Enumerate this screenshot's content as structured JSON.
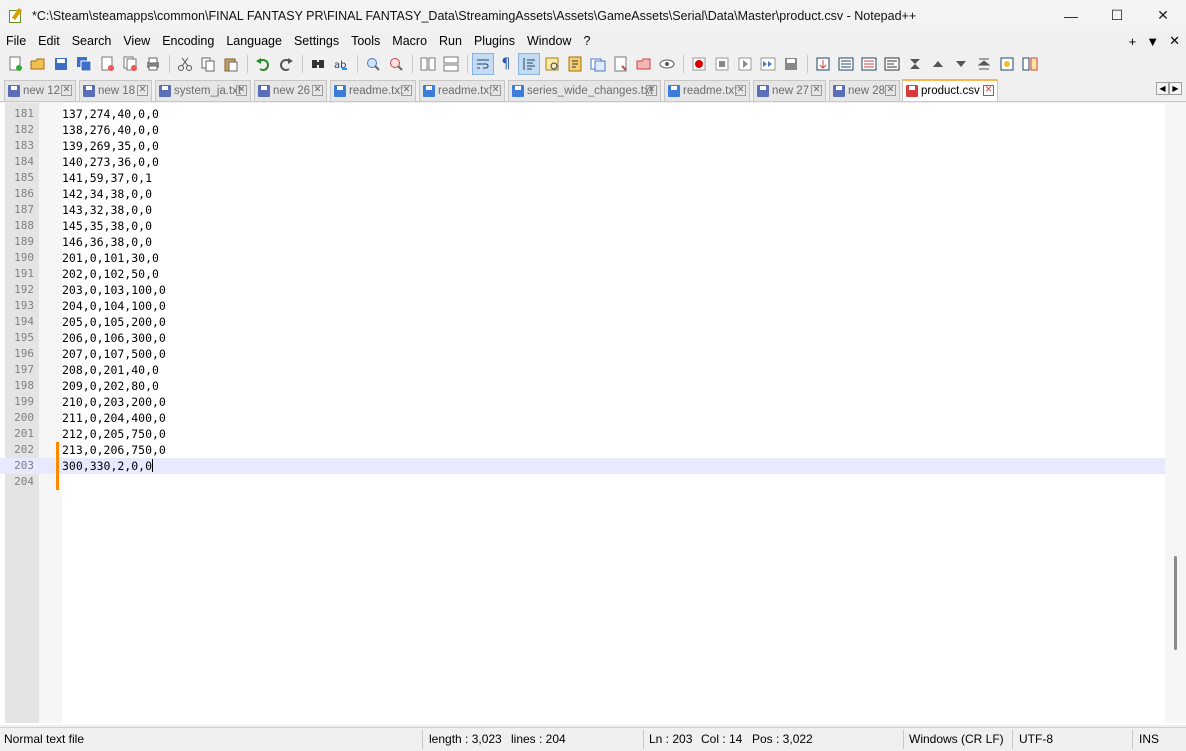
{
  "window": {
    "title": "*C:\\Steam\\steamapps\\common\\FINAL FANTASY PR\\FINAL FANTASY_Data\\StreamingAssets\\Assets\\GameAssets\\Serial\\Data\\Master\\product.csv - Notepad++",
    "minimize": "—",
    "maximize": "☐",
    "close": "✕"
  },
  "menu": {
    "items": [
      "File",
      "Edit",
      "Search",
      "View",
      "Encoding",
      "Language",
      "Settings",
      "Tools",
      "Macro",
      "Run",
      "Plugins",
      "Window",
      "?"
    ],
    "right_plus": "+",
    "right_dropdown": "▼",
    "right_close": "✕"
  },
  "toolbar": {
    "icons": [
      "new-file-icon",
      "open-file-icon",
      "save-icon",
      "save-all-icon",
      "close-icon",
      "close-all-icon",
      "print-icon",
      "cut-icon",
      "copy-icon",
      "paste-icon",
      "undo-icon",
      "redo-icon",
      "find-icon",
      "replace-icon",
      "zoom-in-icon",
      "zoom-out-icon",
      "sync-vertical-icon",
      "sync-horizontal-icon",
      "word-wrap-icon",
      "show-all-chars-icon",
      "indent-guide-icon",
      "doc-map-icon",
      "function-list-icon",
      "folder-workspace-icon",
      "document-list-icon",
      "monitoring-icon",
      "record-macro-icon",
      "stop-macro-icon",
      "play-macro-icon",
      "play-multiple-icon",
      "save-macro-icon",
      "insert-icon",
      "list-icon"
    ]
  },
  "tabs": [
    {
      "label": "new 12",
      "color": "#5b6fb8",
      "active": false
    },
    {
      "label": "new 18",
      "color": "#5b6fb8",
      "active": false
    },
    {
      "label": "system_ja.txt",
      "color": "#5b6fb8",
      "active": false
    },
    {
      "label": "new 26",
      "color": "#5b6fb8",
      "active": false
    },
    {
      "label": "readme.txt",
      "color": "#3b7dd8",
      "active": false
    },
    {
      "label": "readme.txt",
      "color": "#3b7dd8",
      "active": false
    },
    {
      "label": "series_wide_changes.txt",
      "color": "#3b7dd8",
      "active": false
    },
    {
      "label": "readme.txt",
      "color": "#3b7dd8",
      "active": false
    },
    {
      "label": "new 27",
      "color": "#5b6fb8",
      "active": false
    },
    {
      "label": "new 28",
      "color": "#5b6fb8",
      "active": false
    },
    {
      "label": "product.csv",
      "color": "#d83b3b",
      "active": true
    }
  ],
  "tab_close": "✕",
  "tab_scroll_left": "◀",
  "tab_scroll_right": "▶",
  "editor": {
    "lines": [
      {
        "num": "181",
        "text": "137,274,40,0,0"
      },
      {
        "num": "182",
        "text": "138,276,40,0,0"
      },
      {
        "num": "183",
        "text": "139,269,35,0,0"
      },
      {
        "num": "184",
        "text": "140,273,36,0,0"
      },
      {
        "num": "185",
        "text": "141,59,37,0,1"
      },
      {
        "num": "186",
        "text": "142,34,38,0,0"
      },
      {
        "num": "187",
        "text": "143,32,38,0,0"
      },
      {
        "num": "188",
        "text": "145,35,38,0,0"
      },
      {
        "num": "189",
        "text": "146,36,38,0,0"
      },
      {
        "num": "190",
        "text": "201,0,101,30,0"
      },
      {
        "num": "191",
        "text": "202,0,102,50,0"
      },
      {
        "num": "192",
        "text": "203,0,103,100,0"
      },
      {
        "num": "193",
        "text": "204,0,104,100,0"
      },
      {
        "num": "194",
        "text": "205,0,105,200,0"
      },
      {
        "num": "195",
        "text": "206,0,106,300,0"
      },
      {
        "num": "196",
        "text": "207,0,107,500,0"
      },
      {
        "num": "197",
        "text": "208,0,201,40,0"
      },
      {
        "num": "198",
        "text": "209,0,202,80,0"
      },
      {
        "num": "199",
        "text": "210,0,203,200,0"
      },
      {
        "num": "200",
        "text": "211,0,204,400,0"
      },
      {
        "num": "201",
        "text": "212,0,205,750,0"
      },
      {
        "num": "202",
        "text": "213,0,206,750,0"
      },
      {
        "num": "203",
        "text": "300,330,2,0,0"
      },
      {
        "num": "204",
        "text": ""
      }
    ],
    "current_line_index": 22,
    "changed_line_indexes": [
      21,
      22,
      23
    ]
  },
  "status": {
    "file_type": "Normal text file",
    "length": "length : 3,023",
    "lines": "lines : 204",
    "ln": "Ln : 203",
    "col": "Col : 14",
    "pos": "Pos : 3,022",
    "eol": "Windows (CR LF)",
    "encoding": "UTF-8",
    "mode": "INS"
  },
  "colors": {
    "active_tab_accent": "#fab94f",
    "change_bar": "#ff8a00",
    "current_line": "#e8e8ff"
  }
}
